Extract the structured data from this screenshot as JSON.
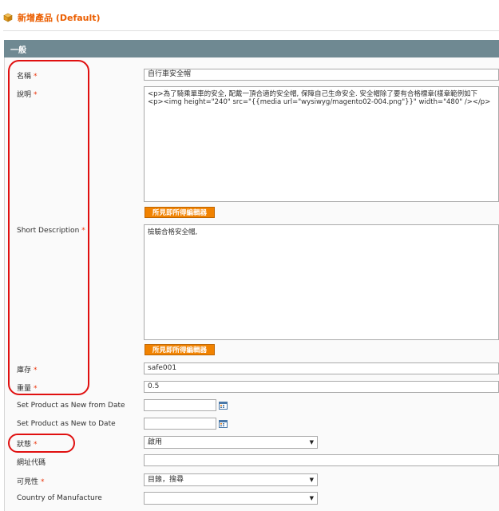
{
  "page": {
    "title": "新增產品 (Default)",
    "icon": "product-cube-icon"
  },
  "section": {
    "title": "一般"
  },
  "fields": {
    "name": {
      "label": "名稱",
      "required": "*",
      "value": "自行車安全帽"
    },
    "description": {
      "label": "說明",
      "required": "*",
      "lines": [
        "<p>為了騎乘單車的安全, 配戴一頂合適的安全帽, 保障自己生命安全. 安全帽除了要有合格標章(樣章範例如下",
        "<p><img height=\"240\" src=\"{{media url=\"wysiwyg/magento02-004.png\"}}\" width=\"480\" /></p>"
      ],
      "wysiwyg_button": "所見即所得編輯器"
    },
    "short_description": {
      "label": "Short Description",
      "required": "*",
      "value": "檢驗合格安全帽,",
      "wysiwyg_button": "所見即所得編輯器"
    },
    "sku": {
      "label": "庫存",
      "required": "*",
      "value": "safe001"
    },
    "weight": {
      "label": "重量",
      "required": "*",
      "value": "0.5"
    },
    "new_from": {
      "label": "Set Product as New from Date",
      "value": ""
    },
    "new_to": {
      "label": "Set Product as New to Date",
      "value": ""
    },
    "status": {
      "label": "狀態",
      "required": "*",
      "value": "啟用"
    },
    "url_key": {
      "label": "網址代碼",
      "value": ""
    },
    "visibility": {
      "label": "可見性",
      "required": "*",
      "value": "目錄，搜尋"
    },
    "country": {
      "label": "Country of Manufacture",
      "value": ""
    }
  },
  "colors": {
    "title_orange": "#eb5e00",
    "header_bg": "#6f8992",
    "button_orange": "#f18200",
    "annotation_red": "#e01010"
  }
}
